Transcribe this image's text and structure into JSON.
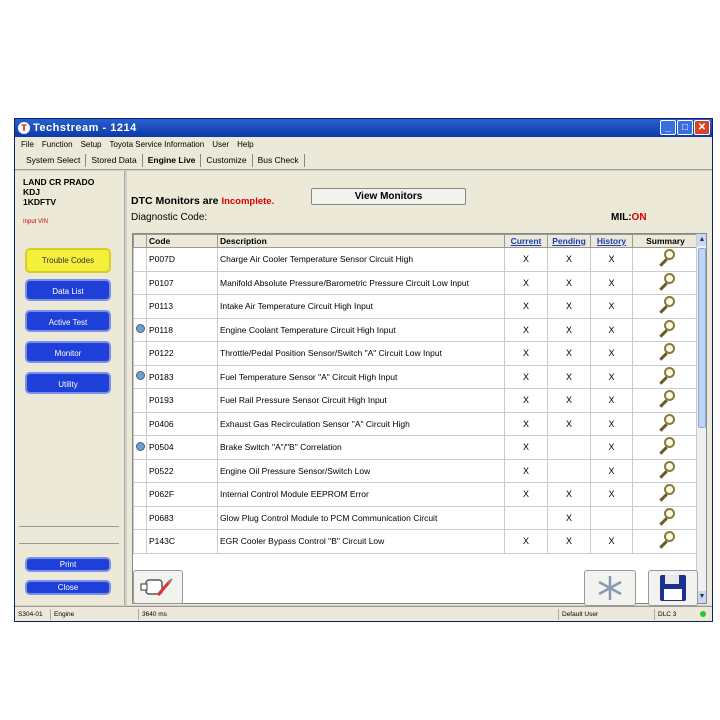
{
  "window": {
    "title": "Techstream - 1214"
  },
  "menu": [
    "File",
    "Function",
    "Setup",
    "Toyota Service Information",
    "User",
    "Help"
  ],
  "tabs": [
    {
      "label": "System Select"
    },
    {
      "label": "Stored Data"
    },
    {
      "label": "Engine Live"
    },
    {
      "label": "Customize"
    },
    {
      "label": "Bus Check"
    }
  ],
  "vehicle": {
    "line1": "LAND CR PRADO",
    "line2": "KDJ",
    "line3": "1KDFTV",
    "input_vin": "Input VIN"
  },
  "sidebar": {
    "trouble_codes": "Trouble Codes",
    "data_list": "Data List",
    "active_test": "Active Test",
    "monitor": "Monitor",
    "utility": "Utility",
    "print": "Print",
    "close": "Close"
  },
  "header": {
    "dtc_prefix": "DTC Monitors are",
    "dtc_status": "Incomplete.",
    "view_monitors": "View Monitors",
    "diag_code": "Diagnostic Code:",
    "mil_label": "MIL:",
    "mil_value": "ON"
  },
  "table": {
    "columns": [
      "Code",
      "Description",
      "Current",
      "Pending",
      "History",
      "Summary"
    ],
    "rows": [
      {
        "flag": false,
        "code": "P007D",
        "desc": "Charge Air Cooler Temperature Sensor Circuit High",
        "current": "X",
        "pending": "X",
        "history": "X"
      },
      {
        "flag": false,
        "code": "P0107",
        "desc": "Manifold Absolute Pressure/Barometric Pressure Circuit Low Input",
        "current": "X",
        "pending": "X",
        "history": "X"
      },
      {
        "flag": false,
        "code": "P0113",
        "desc": "Intake Air Temperature Circuit High Input",
        "current": "X",
        "pending": "X",
        "history": "X"
      },
      {
        "flag": true,
        "code": "P0118",
        "desc": "Engine Coolant Temperature Circuit High Input",
        "current": "X",
        "pending": "X",
        "history": "X"
      },
      {
        "flag": false,
        "code": "P0122",
        "desc": "Throttle/Pedal Position Sensor/Switch \"A\" Circuit Low Input",
        "current": "X",
        "pending": "X",
        "history": "X"
      },
      {
        "flag": true,
        "code": "P0183",
        "desc": "Fuel Temperature Sensor \"A\" Circuit High Input",
        "current": "X",
        "pending": "X",
        "history": "X"
      },
      {
        "flag": false,
        "code": "P0193",
        "desc": "Fuel Rail Pressure Sensor Circuit High Input",
        "current": "X",
        "pending": "X",
        "history": "X"
      },
      {
        "flag": false,
        "code": "P0406",
        "desc": "Exhaust Gas Recirculation Sensor \"A\" Circuit High",
        "current": "X",
        "pending": "X",
        "history": "X"
      },
      {
        "flag": true,
        "code": "P0504",
        "desc": "Brake Switch \"A\"/\"B\" Correlation",
        "current": "X",
        "pending": "",
        "history": "X"
      },
      {
        "flag": false,
        "code": "P0522",
        "desc": "Engine Oil Pressure Sensor/Switch Low",
        "current": "X",
        "pending": "",
        "history": "X"
      },
      {
        "flag": false,
        "code": "P062F",
        "desc": "Internal Control Module EEPROM Error",
        "current": "X",
        "pending": "X",
        "history": "X"
      },
      {
        "flag": false,
        "code": "P0683",
        "desc": "Glow Plug Control Module to PCM Communication Circuit",
        "current": "",
        "pending": "X",
        "history": ""
      },
      {
        "flag": false,
        "code": "P143C",
        "desc": "EGR Cooler Bypass Control \"B\" Circuit Low",
        "current": "X",
        "pending": "X",
        "history": "X"
      }
    ]
  },
  "status": {
    "ecu": "S304-01",
    "system": "Engine",
    "time": "3640 ms",
    "user": "Default User",
    "dlc": "DLC 3"
  },
  "icons": {
    "flag": "info-flag-icon",
    "summary": "magnifier-icon",
    "clear": "clear-dtc-icon",
    "freeze": "snowflake-icon",
    "save": "floppy-disk-icon"
  }
}
